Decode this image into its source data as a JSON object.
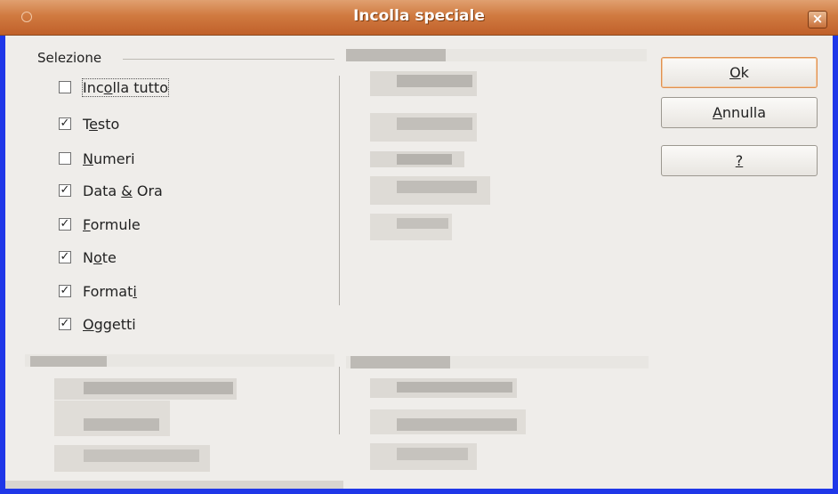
{
  "dialog": {
    "title": "Incolla speciale",
    "close_glyph": "×"
  },
  "selection": {
    "label": "Selezione",
    "items": [
      {
        "pre": "Inc",
        "key": "o",
        "post": "lla tutto",
        "checked": false
      },
      {
        "pre": "T",
        "key": "e",
        "post": "sto",
        "checked": true
      },
      {
        "pre": "",
        "key": "N",
        "post": "umeri",
        "checked": false
      },
      {
        "pre": "Data ",
        "key": "&",
        "post": " Ora",
        "checked": true
      },
      {
        "pre": "",
        "key": "F",
        "post": "ormule",
        "checked": true
      },
      {
        "pre": "N",
        "key": "o",
        "post": "te",
        "checked": true
      },
      {
        "pre": "Format",
        "key": "i",
        "post": "",
        "checked": true
      },
      {
        "pre": "",
        "key": "O",
        "post": "ggetti",
        "checked": true
      }
    ]
  },
  "buttons": {
    "ok": {
      "pre": "",
      "key": "O",
      "post": "k"
    },
    "cancel": {
      "pre": "",
      "key": "A",
      "post": "nnulla"
    },
    "help": {
      "pre": "",
      "key": "?",
      "post": ""
    }
  },
  "icons": {
    "window": "circle-icon",
    "close": "close-icon",
    "check": "✓"
  }
}
